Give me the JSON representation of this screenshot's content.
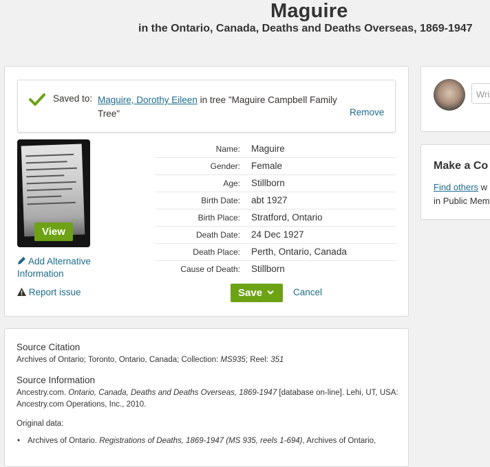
{
  "header": {
    "name": "Maguire",
    "collection": "in the Ontario, Canada, Deaths and Deaths Overseas, 1869-1947"
  },
  "saved": {
    "label": "Saved to:",
    "person_link": "Maguire, Dorothy Eileen",
    "tree_text": " in tree \"Maguire Campbell Family Tree\"",
    "remove_label": "Remove"
  },
  "image": {
    "view_label": "View"
  },
  "actions": {
    "add_alternative": "Add Alternative Information",
    "report_issue": "Report issue",
    "save_label": "Save",
    "cancel_label": "Cancel"
  },
  "facts": [
    {
      "label": "Name:",
      "value": "Maguire"
    },
    {
      "label": "Gender:",
      "value": "Female"
    },
    {
      "label": "Age:",
      "value": "Stillborn"
    },
    {
      "label": "Birth Date:",
      "value": "abt 1927"
    },
    {
      "label": "Birth Place:",
      "value": "Stratford, Ontario"
    },
    {
      "label": "Death Date:",
      "value": "24 Dec 1927"
    },
    {
      "label": "Death Place:",
      "value": "Perth, Ontario, Canada"
    },
    {
      "label": "Cause of Death:",
      "value": "Stillborn"
    }
  ],
  "citation": {
    "source_citation_heading": "Source Citation",
    "source_citation_prefix": "Archives of Ontario; Toronto, Ontario, Canada; Collection: ",
    "source_citation_collection": "MS935",
    "source_citation_reel_prefix": "; Reel: ",
    "source_citation_reel": "351",
    "source_info_heading": "Source Information",
    "source_info_prefix": "Ancestry.com. ",
    "source_info_title": "Ontario, Canada, Deaths and Deaths Overseas, 1869-1947",
    "source_info_suffix": " [database on-line]. Lehi, UT, USA: Ancestry.com Operations, Inc., 2010.",
    "original_data_heading": "Original data:",
    "original_item_prefix": "Archives of Ontario. ",
    "original_item_title": "Registrations of Deaths, 1869-1947 (MS 935, reels 1-694)",
    "original_item_suffix": ", Archives of Ontario,"
  },
  "comment": {
    "placeholder": "Write"
  },
  "connect": {
    "heading": "Make a Co",
    "link": "Find others",
    "text_1_suffix": " w",
    "text_2": "in Public Mem"
  },
  "colors": {
    "accent_green": "#6da214",
    "link_blue": "#1d6b8b",
    "check_green": "#6da214"
  }
}
